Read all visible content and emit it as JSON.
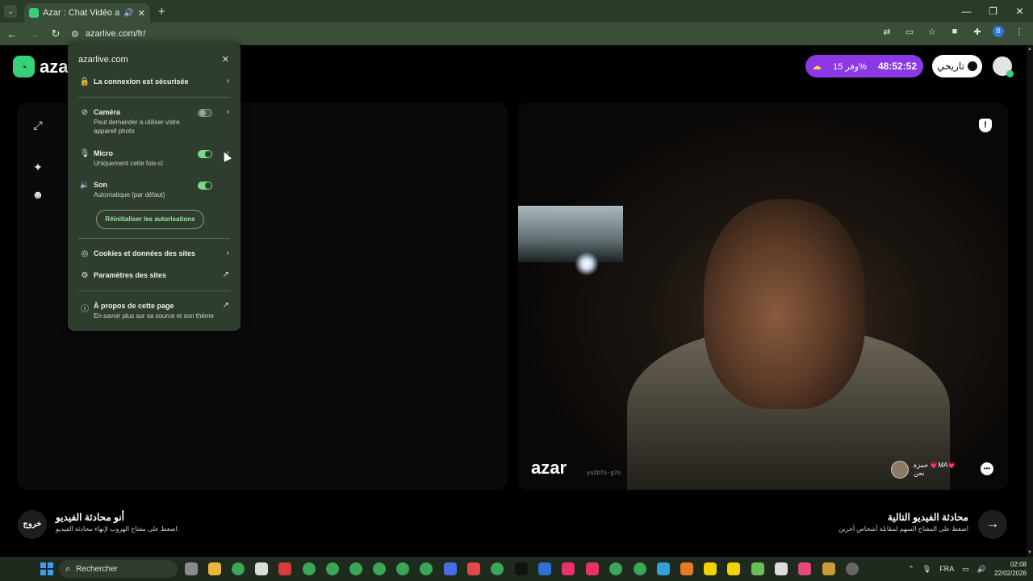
{
  "browser": {
    "tab_title": "Azar : Chat Vidéo avec de",
    "url": "azarlive.com/fr/",
    "profile_initial": "B"
  },
  "site": {
    "logo_text": "azar",
    "promo": {
      "timer": "48:52:52",
      "offer": "وفر 15%"
    },
    "history_label": "تاريخي",
    "watermark": "azar",
    "peer_id": "yuIbTs-g7o",
    "peer_name": "حمزة 💗MA💗",
    "peer_country": "نحن",
    "end_chat": {
      "button": "خروج",
      "title": "أنو محادثة الفيديو",
      "subtitle": "اضغط على مفتاح الهروب لإنهاء محادثة الفيديو."
    },
    "next_chat": {
      "title": "محادثة الفيديو التالية",
      "subtitle": "اضغط على المفتاح السهم لمقابلة أشخاص آخرين"
    }
  },
  "site_info": {
    "host": "azarlive.com",
    "secure": "La connexion est sécurisée",
    "camera": {
      "label": "Caméra",
      "desc": "Peut demander à utiliser votre appareil photo",
      "enabled": false
    },
    "micro": {
      "label": "Micro",
      "desc": "Uniquement cette fois-ci",
      "enabled": true
    },
    "sound": {
      "label": "Son",
      "desc": "Automatique (par défaut)",
      "enabled": true
    },
    "reset": "Réinitialiser les autorisations",
    "cookies": "Cookies et données des sites",
    "site_settings": "Paramètres des sites",
    "about": {
      "label": "À propos de cette page",
      "desc": "En savoir plus sur sa source et son thème"
    }
  },
  "taskbar": {
    "search_placeholder": "Rechercher",
    "lang": "FRA",
    "time": "02:08",
    "date": "22/02/2026"
  },
  "colors": {
    "accent_green": "#35d17a",
    "promo_purple": "#8b38e5",
    "chrome_bg": "#2b3b2a",
    "popup_bg": "#2f3d2e"
  }
}
